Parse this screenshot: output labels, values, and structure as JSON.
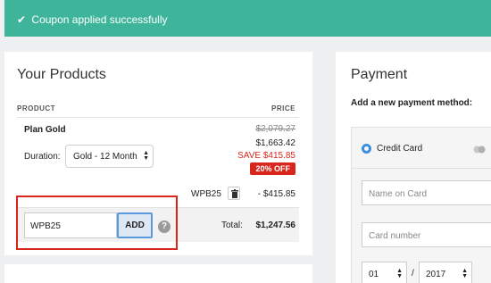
{
  "alert": {
    "message": "Coupon applied successfully",
    "color": "#3eb59a"
  },
  "products": {
    "title": "Your Products",
    "col_product": "PRODUCT",
    "col_price": "PRICE",
    "item": {
      "name": "Plan Gold",
      "duration_label": "Duration:",
      "duration_value": "Gold - 12 Month",
      "original_price": "$2,079.27",
      "price": "$1,663.42",
      "save": "SAVE $415.85",
      "badge": "20% OFF"
    },
    "applied_code": "WPB25",
    "discount": "- $415.85",
    "coupon": {
      "value": "WPB25",
      "add_label": "ADD",
      "help": "?"
    },
    "total_label": "Total:",
    "total_value": "$1,247.56"
  },
  "payment": {
    "title": "Payment",
    "subtitle": "Add a new payment method:",
    "method": "Credit Card",
    "name_placeholder": "Name on Card",
    "number_placeholder": "Card number",
    "month": "01",
    "separator": "/",
    "year": "2017"
  },
  "colors": {
    "accent_red": "#d9261c",
    "radio_blue": "#3c8fe0"
  }
}
